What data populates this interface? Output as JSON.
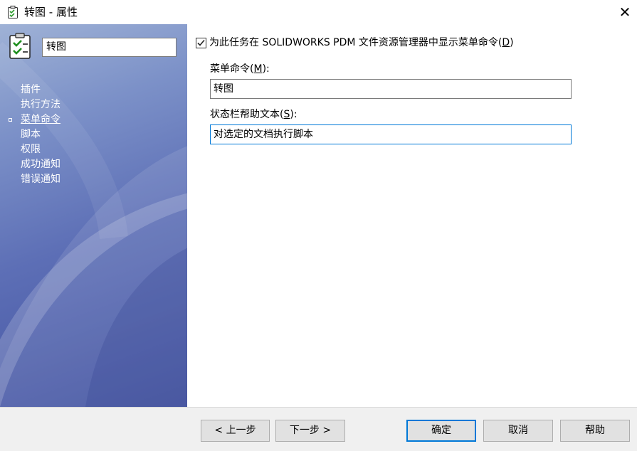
{
  "window": {
    "title": "转图 - 属性",
    "close_symbol": "✕",
    "icon": "task-clipboard-icon"
  },
  "sidebar": {
    "name_value": "转图",
    "items": [
      {
        "label": "插件"
      },
      {
        "label": "执行方法"
      },
      {
        "label": "菜单命令",
        "active": true
      },
      {
        "label": "脚本"
      },
      {
        "label": "权限"
      },
      {
        "label": "成功通知"
      },
      {
        "label": "错误通知"
      }
    ]
  },
  "main": {
    "show_menu_checkbox": {
      "checked": true,
      "label": "为此任务在 SOLIDWORKS PDM 文件资源管理器中显示菜单命令(",
      "accel": "D",
      "label_end": ")"
    },
    "menu_command": {
      "label": "菜单命令(",
      "accel": "M",
      "label_end": "):",
      "value": "转图"
    },
    "status_help": {
      "label": "状态栏帮助文本(",
      "accel": "S",
      "label_end": "):",
      "value": "对选定的文档执行脚本"
    }
  },
  "footer": {
    "back_label": "< 上一步",
    "next_label": "下一步 >",
    "ok_label": "确定",
    "cancel_label": "取消",
    "help_label": "帮助"
  },
  "colors": {
    "accent": "#0078d7",
    "sidebar_gradient_top": "#9fb2d6",
    "sidebar_gradient_bottom": "#3f4f9e",
    "footer_bg": "#f0f0f0"
  }
}
